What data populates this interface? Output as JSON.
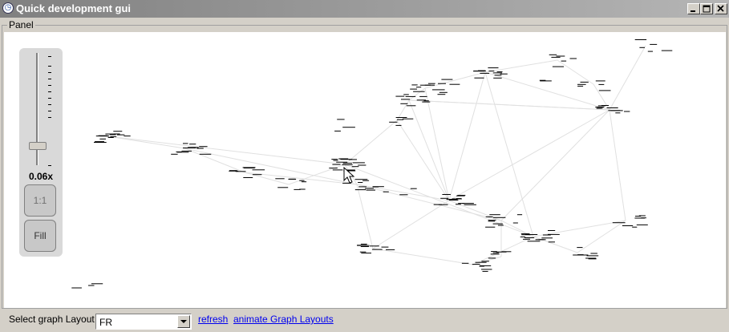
{
  "window": {
    "title": "Quick development gui",
    "icon": "clock-icon"
  },
  "panel": {
    "legend": "Panel"
  },
  "zoom": {
    "level_label": "0.06x",
    "one_to_one_label": "1:1",
    "fill_label": "Fill",
    "slider_level": 0.1
  },
  "footer": {
    "layout_label": "Select graph Layout",
    "layout_selected": "FR",
    "refresh_label": "refresh",
    "animate_label": "animate Graph Layouts"
  },
  "colors": {
    "link": "#0000ee",
    "edge": "#e0e0e0",
    "node": "#000000"
  }
}
